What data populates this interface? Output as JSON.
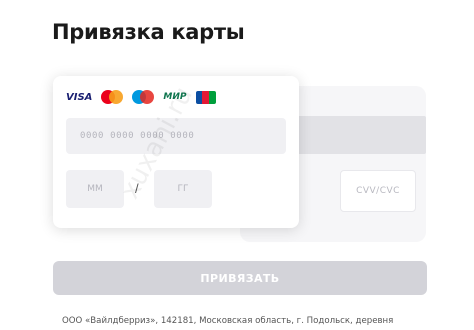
{
  "page": {
    "title": "Привязка карты"
  },
  "card_logos": [
    {
      "name": "visa-logo",
      "text": "VISA",
      "color": "#1a1f71"
    },
    {
      "name": "mastercard-logo",
      "colors": [
        "#eb001b",
        "#f79e1b"
      ]
    },
    {
      "name": "maestro-logo",
      "colors": [
        "#0099df",
        "#e4261f"
      ]
    },
    {
      "name": "mir-logo",
      "text": "МИР",
      "color": "#0f754e"
    },
    {
      "name": "jcb-logo",
      "colors": [
        "#0b4ea2",
        "#e21836",
        "#009f3c"
      ]
    }
  ],
  "form": {
    "card_number_placeholder": "0000 0000 0000 0000",
    "month_placeholder": "ММ",
    "separator": "/",
    "year_placeholder": "ГГ",
    "cvv_placeholder": "CVV/CVC"
  },
  "submit": {
    "label": "ПРИВЯЗАТЬ",
    "color": "#d3d3d9"
  },
  "footer": {
    "text": "ООО «Вайлдберриз», 142181, Московская область, г. Подольск, деревня"
  },
  "watermark": "xuxani.ru"
}
